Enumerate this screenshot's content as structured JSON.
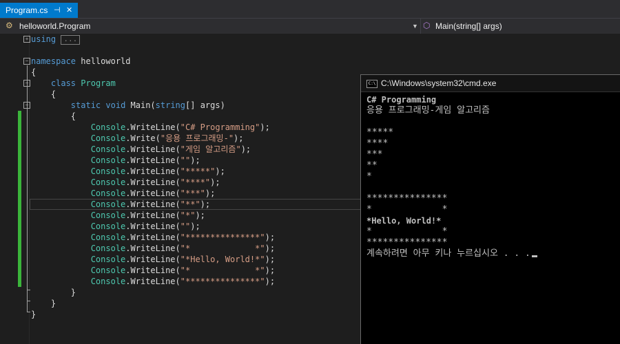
{
  "tab": {
    "title": "Program.cs",
    "pin": "⊣",
    "close": "✕"
  },
  "navbar": {
    "class_selector": "helloworld.Program",
    "member_selector": "Main(string[] args)"
  },
  "code": {
    "using_kw": "using",
    "using_collapsed": "...",
    "ns_kw": "namespace",
    "ns_name": " helloworld",
    "open_brace": "{",
    "close_brace": "}",
    "class_kw": "class",
    "class_name": "Program",
    "static_kw": "static",
    "void_kw": "void",
    "main_name": " Main(",
    "string_kw": "string",
    "main_rest": "[] args)",
    "console_cls": "Console",
    "statements": [
      {
        "method": ".WriteLine(",
        "arg": "\"C# Programming\"",
        "end": ");"
      },
      {
        "method": ".Write(",
        "arg": "\"응용 프로그래밍-\"",
        "end": ");"
      },
      {
        "method": ".WriteLine(",
        "arg": "\"게임 알고리즘\"",
        "end": ");"
      },
      {
        "method": ".WriteLine(",
        "arg": "\"\"",
        "end": ");"
      },
      {
        "method": ".WriteLine(",
        "arg": "\"*****\"",
        "end": ");"
      },
      {
        "method": ".WriteLine(",
        "arg": "\"****\"",
        "end": ");"
      },
      {
        "method": ".WriteLine(",
        "arg": "\"***\"",
        "end": ");"
      },
      {
        "method": ".WriteLine(",
        "arg": "\"**\"",
        "end": ");"
      },
      {
        "method": ".WriteLine(",
        "arg": "\"*\"",
        "end": ");"
      },
      {
        "method": ".WriteLine(",
        "arg": "\"\"",
        "end": ");"
      },
      {
        "method": ".WriteLine(",
        "arg": "\"***************\"",
        "end": ");"
      },
      {
        "method": ".WriteLine(",
        "arg": "\"*             *\"",
        "end": ");"
      },
      {
        "method": ".WriteLine(",
        "arg": "\"*Hello, World!*\"",
        "end": ");"
      },
      {
        "method": ".WriteLine(",
        "arg": "\"*             *\"",
        "end": ");"
      },
      {
        "method": ".WriteLine(",
        "arg": "\"***************\"",
        "end": ");"
      }
    ]
  },
  "console": {
    "title": "C:\\Windows\\system32\\cmd.exe",
    "icon_text": "C:\\",
    "lines": [
      "C# Programming",
      "응용 프로그래밍-게임 알고리즘",
      "",
      "*****",
      "****",
      "***",
      "**",
      "*",
      "",
      "***************",
      "*             *",
      "*Hello, World!*",
      "*             *",
      "***************",
      "계속하려면 아무 키나 누르십시오 . . ."
    ]
  },
  "colors": {
    "accent": "#007acc",
    "keyword": "#569cd6",
    "type": "#4ec9b0",
    "string": "#d69d85",
    "change_marker": "#3bb53b"
  }
}
